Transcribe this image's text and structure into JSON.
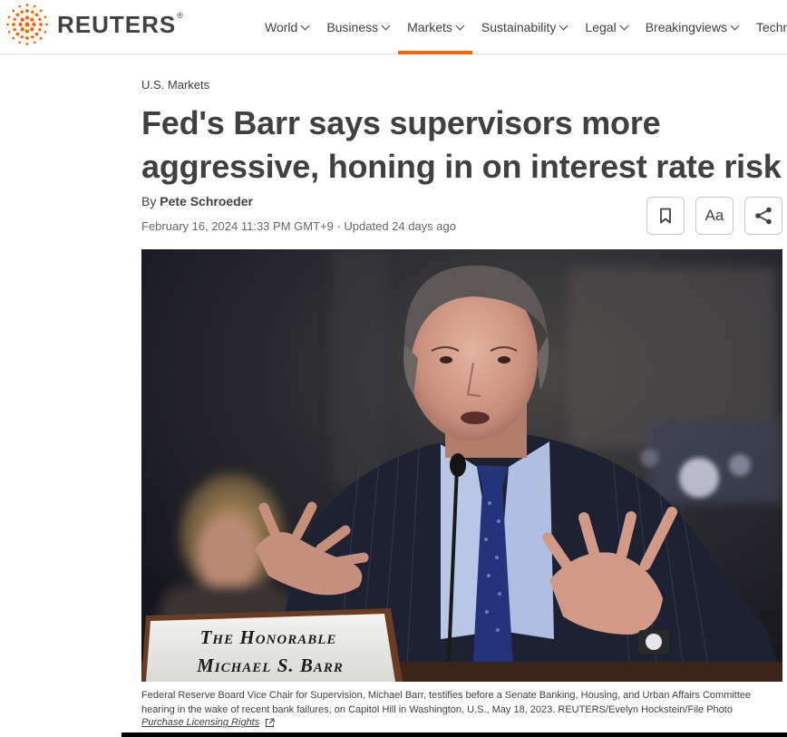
{
  "header": {
    "brand": "REUTERS",
    "registered_mark": "®",
    "nav": [
      {
        "label": "World",
        "active": false
      },
      {
        "label": "Business",
        "active": false
      },
      {
        "label": "Markets",
        "active": true
      },
      {
        "label": "Sustainability",
        "active": false
      },
      {
        "label": "Legal",
        "active": false
      },
      {
        "label": "Breakingviews",
        "active": false
      },
      {
        "label": "Techno",
        "active": false
      }
    ],
    "accent_color": "#fa6400"
  },
  "article": {
    "kicker": "U.S. Markets",
    "headline_line1": "Fed's Barr says supervisors more",
    "headline_line2": "aggressive, honing in on interest rate risk",
    "byline_prefix": "By",
    "author": "Pete Schroeder",
    "dateline": "February 16, 2024 11:33 PM GMT+9 · Updated 24 days ago",
    "tools": {
      "bookmark_icon": "bookmark-icon",
      "text_size_label": "Aa",
      "share_icon": "share-icon"
    },
    "photo": {
      "placard_line1": "The Honorable",
      "placard_line2": "Michael S. Barr"
    },
    "caption_line1": "Federal Reserve Board Vice Chair for Supervision, Michael Barr, testifies before a Senate Banking, Housing, and Urban Affairs Committee",
    "caption_line2": "hearing in the wake of recent bank failures, on Capitol Hill in Washington, U.S., May 18, 2023. REUTERS/Evelyn Hockstein/File Photo",
    "licensing_link": "Purchase Licensing Rights",
    "licensing_icon": "external-link-icon"
  }
}
